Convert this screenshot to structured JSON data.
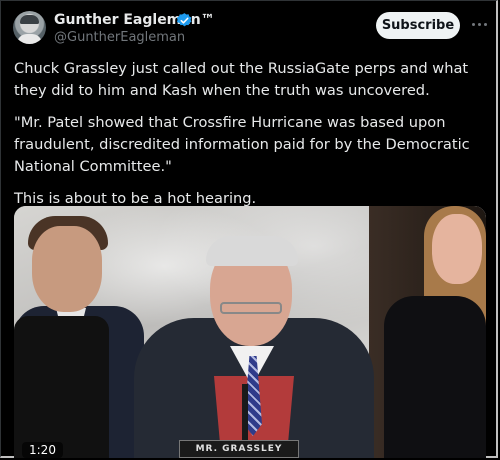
{
  "author": {
    "name": "Gunther Eagleman™",
    "handle": "@GuntherEagleman",
    "verified": true
  },
  "actions": {
    "subscribe_label": "Subscribe",
    "more_icon": "more-horizontal-icon"
  },
  "tweet": {
    "paragraphs": [
      "Chuck Grassley just called out the RussiaGate perps and what they did to him and Kash when the truth was uncovered.",
      "\"Mr. Patel showed that Crossfire Hurricane was based upon fraudulent, discredited information paid for by the Democratic National Committee.\"",
      "This is about to be a hot hearing."
    ]
  },
  "media": {
    "video_timestamp": "1:20",
    "nameplate_text": "MR. GRASSLEY"
  },
  "colors": {
    "background": "#000000",
    "verified_badge": "#1d9bf0",
    "subscribe_bg": "#eff3f4"
  }
}
